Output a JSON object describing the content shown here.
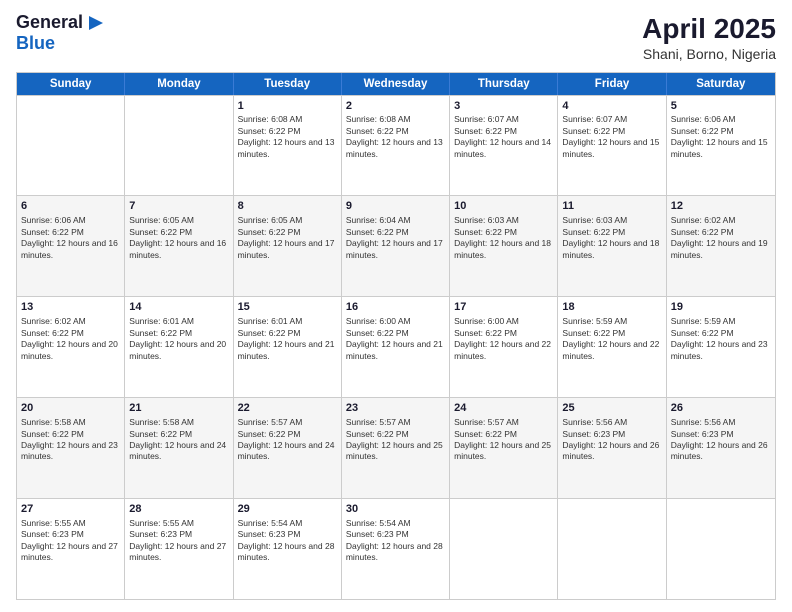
{
  "header": {
    "logo_general": "General",
    "logo_blue": "Blue",
    "month_title": "April 2025",
    "location": "Shani, Borno, Nigeria"
  },
  "calendar": {
    "days_of_week": [
      "Sunday",
      "Monday",
      "Tuesday",
      "Wednesday",
      "Thursday",
      "Friday",
      "Saturday"
    ],
    "rows": [
      [
        {
          "day": "",
          "text": ""
        },
        {
          "day": "",
          "text": ""
        },
        {
          "day": "1",
          "text": "Sunrise: 6:08 AM\nSunset: 6:22 PM\nDaylight: 12 hours and 13 minutes."
        },
        {
          "day": "2",
          "text": "Sunrise: 6:08 AM\nSunset: 6:22 PM\nDaylight: 12 hours and 13 minutes."
        },
        {
          "day": "3",
          "text": "Sunrise: 6:07 AM\nSunset: 6:22 PM\nDaylight: 12 hours and 14 minutes."
        },
        {
          "day": "4",
          "text": "Sunrise: 6:07 AM\nSunset: 6:22 PM\nDaylight: 12 hours and 15 minutes."
        },
        {
          "day": "5",
          "text": "Sunrise: 6:06 AM\nSunset: 6:22 PM\nDaylight: 12 hours and 15 minutes."
        }
      ],
      [
        {
          "day": "6",
          "text": "Sunrise: 6:06 AM\nSunset: 6:22 PM\nDaylight: 12 hours and 16 minutes."
        },
        {
          "day": "7",
          "text": "Sunrise: 6:05 AM\nSunset: 6:22 PM\nDaylight: 12 hours and 16 minutes."
        },
        {
          "day": "8",
          "text": "Sunrise: 6:05 AM\nSunset: 6:22 PM\nDaylight: 12 hours and 17 minutes."
        },
        {
          "day": "9",
          "text": "Sunrise: 6:04 AM\nSunset: 6:22 PM\nDaylight: 12 hours and 17 minutes."
        },
        {
          "day": "10",
          "text": "Sunrise: 6:03 AM\nSunset: 6:22 PM\nDaylight: 12 hours and 18 minutes."
        },
        {
          "day": "11",
          "text": "Sunrise: 6:03 AM\nSunset: 6:22 PM\nDaylight: 12 hours and 18 minutes."
        },
        {
          "day": "12",
          "text": "Sunrise: 6:02 AM\nSunset: 6:22 PM\nDaylight: 12 hours and 19 minutes."
        }
      ],
      [
        {
          "day": "13",
          "text": "Sunrise: 6:02 AM\nSunset: 6:22 PM\nDaylight: 12 hours and 20 minutes."
        },
        {
          "day": "14",
          "text": "Sunrise: 6:01 AM\nSunset: 6:22 PM\nDaylight: 12 hours and 20 minutes."
        },
        {
          "day": "15",
          "text": "Sunrise: 6:01 AM\nSunset: 6:22 PM\nDaylight: 12 hours and 21 minutes."
        },
        {
          "day": "16",
          "text": "Sunrise: 6:00 AM\nSunset: 6:22 PM\nDaylight: 12 hours and 21 minutes."
        },
        {
          "day": "17",
          "text": "Sunrise: 6:00 AM\nSunset: 6:22 PM\nDaylight: 12 hours and 22 minutes."
        },
        {
          "day": "18",
          "text": "Sunrise: 5:59 AM\nSunset: 6:22 PM\nDaylight: 12 hours and 22 minutes."
        },
        {
          "day": "19",
          "text": "Sunrise: 5:59 AM\nSunset: 6:22 PM\nDaylight: 12 hours and 23 minutes."
        }
      ],
      [
        {
          "day": "20",
          "text": "Sunrise: 5:58 AM\nSunset: 6:22 PM\nDaylight: 12 hours and 23 minutes."
        },
        {
          "day": "21",
          "text": "Sunrise: 5:58 AM\nSunset: 6:22 PM\nDaylight: 12 hours and 24 minutes."
        },
        {
          "day": "22",
          "text": "Sunrise: 5:57 AM\nSunset: 6:22 PM\nDaylight: 12 hours and 24 minutes."
        },
        {
          "day": "23",
          "text": "Sunrise: 5:57 AM\nSunset: 6:22 PM\nDaylight: 12 hours and 25 minutes."
        },
        {
          "day": "24",
          "text": "Sunrise: 5:57 AM\nSunset: 6:22 PM\nDaylight: 12 hours and 25 minutes."
        },
        {
          "day": "25",
          "text": "Sunrise: 5:56 AM\nSunset: 6:23 PM\nDaylight: 12 hours and 26 minutes."
        },
        {
          "day": "26",
          "text": "Sunrise: 5:56 AM\nSunset: 6:23 PM\nDaylight: 12 hours and 26 minutes."
        }
      ],
      [
        {
          "day": "27",
          "text": "Sunrise: 5:55 AM\nSunset: 6:23 PM\nDaylight: 12 hours and 27 minutes."
        },
        {
          "day": "28",
          "text": "Sunrise: 5:55 AM\nSunset: 6:23 PM\nDaylight: 12 hours and 27 minutes."
        },
        {
          "day": "29",
          "text": "Sunrise: 5:54 AM\nSunset: 6:23 PM\nDaylight: 12 hours and 28 minutes."
        },
        {
          "day": "30",
          "text": "Sunrise: 5:54 AM\nSunset: 6:23 PM\nDaylight: 12 hours and 28 minutes."
        },
        {
          "day": "",
          "text": ""
        },
        {
          "day": "",
          "text": ""
        },
        {
          "day": "",
          "text": ""
        }
      ]
    ]
  }
}
